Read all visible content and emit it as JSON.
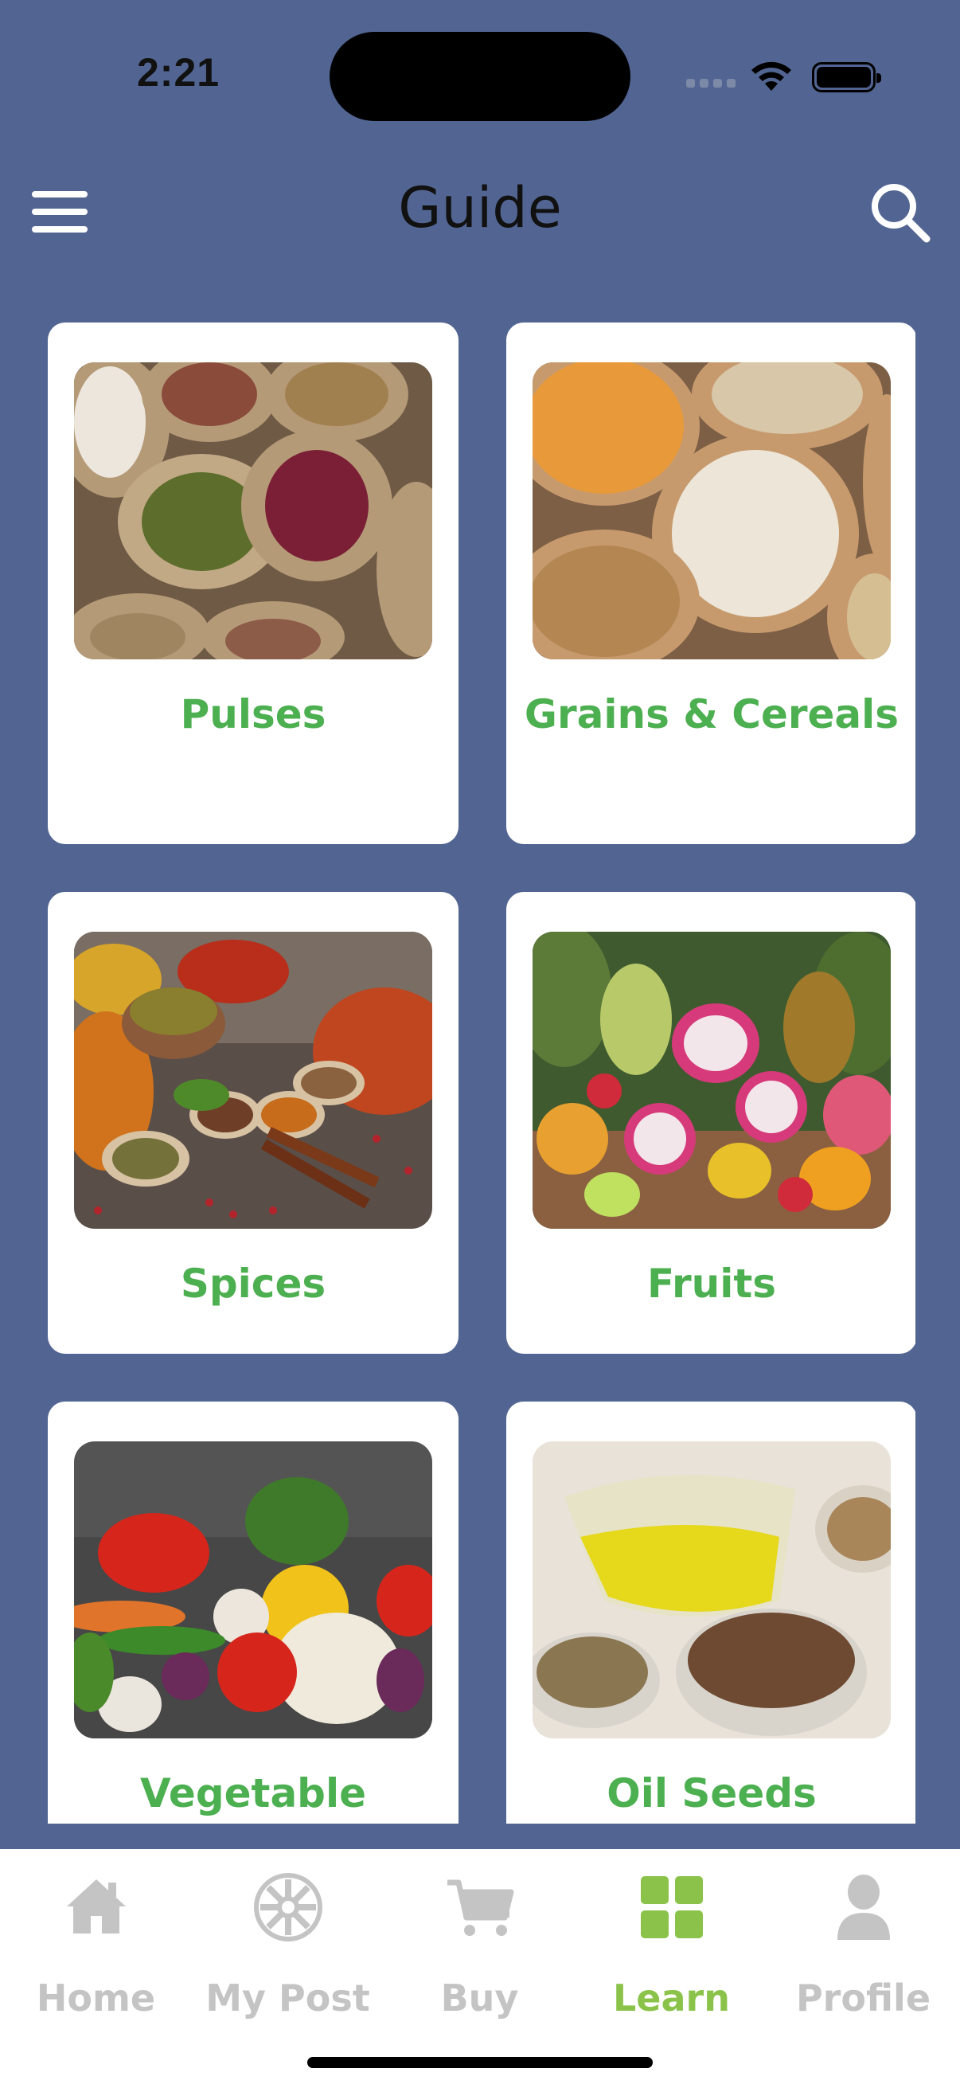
{
  "status_bar": {
    "time": "2:21"
  },
  "header": {
    "title": "Guide"
  },
  "categories": [
    {
      "label": "Pulses",
      "image_desc": "sacks of beans and lentils"
    },
    {
      "label": "Grains & Cereals",
      "image_desc": "sacks of corn, oats, rice and wheat"
    },
    {
      "label": "Spices",
      "image_desc": "spice powders in bowls and spoons"
    },
    {
      "label": "Fruits",
      "image_desc": "dragon fruit, grapes, pineapple and mango"
    },
    {
      "label": "Vegetable",
      "image_desc": "peppers, broccoli, cauliflower and tomatoes"
    },
    {
      "label": "Oil Seeds",
      "image_desc": "oil jug with flax and sesame seeds"
    }
  ],
  "tabbar": {
    "items": [
      {
        "label": "Home",
        "icon": "home-icon",
        "active": false
      },
      {
        "label": "My Post",
        "icon": "my-post-icon",
        "active": false
      },
      {
        "label": "Buy",
        "icon": "cart-icon",
        "active": false
      },
      {
        "label": "Learn",
        "icon": "grid-icon",
        "active": true
      },
      {
        "label": "Profile",
        "icon": "profile-icon",
        "active": false
      }
    ]
  },
  "colors": {
    "background": "#526592",
    "card": "#ffffff",
    "label_green": "#4caf50",
    "active_tab": "#8bc34a",
    "inactive_tab": "#c4c4c4"
  }
}
